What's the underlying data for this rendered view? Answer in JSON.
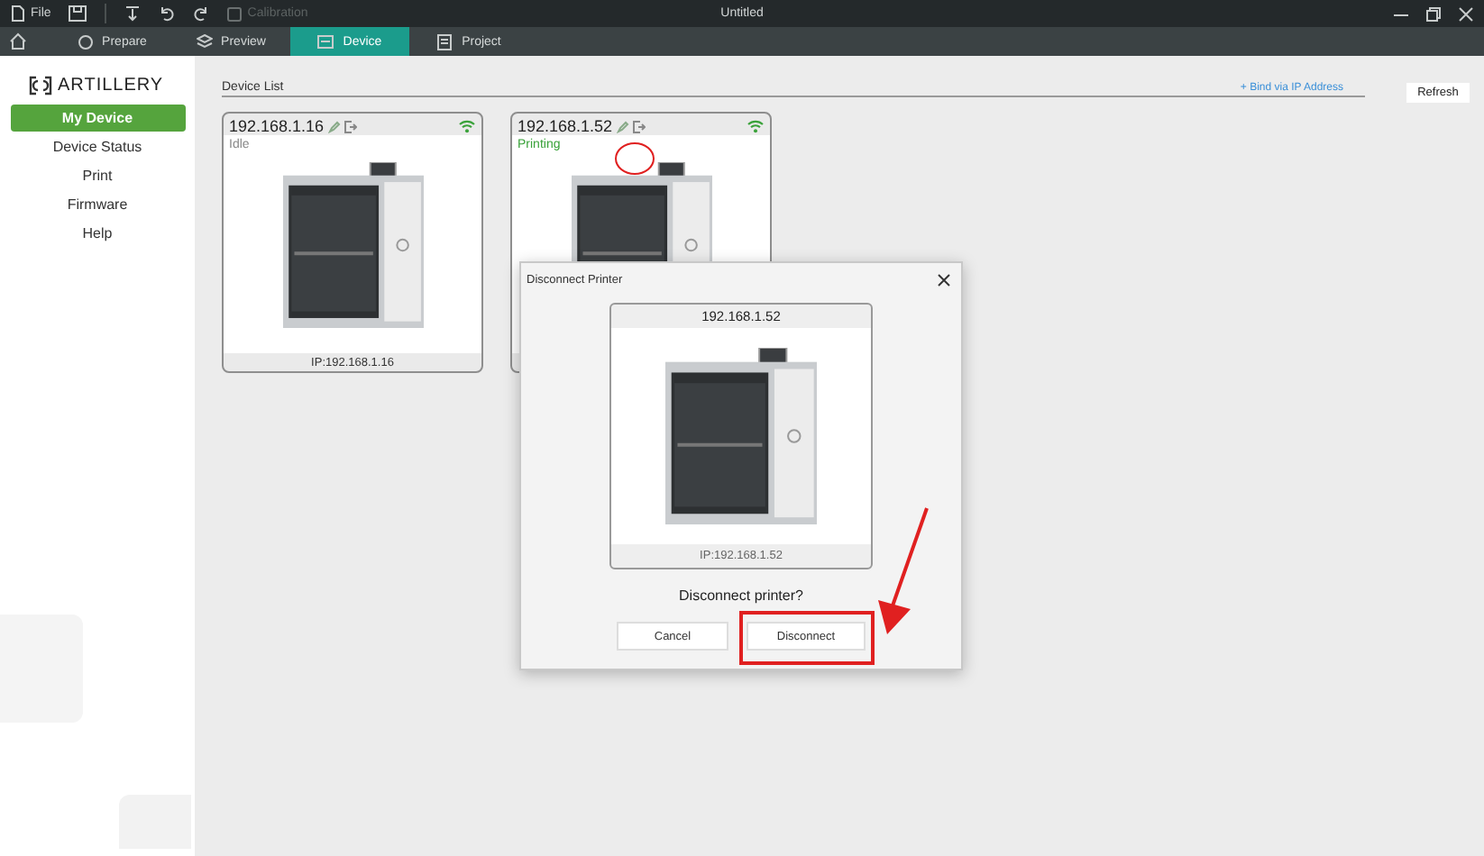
{
  "window": {
    "title": "Untitled"
  },
  "menu": {
    "file": "File",
    "items": [
      {
        "label": "Calibration",
        "disabled": true
      }
    ]
  },
  "tabs": [
    {
      "label": "Prepare",
      "selected": false
    },
    {
      "label": "Preview",
      "selected": false
    },
    {
      "label": "Device",
      "selected": true
    },
    {
      "label": "Project",
      "selected": false
    }
  ],
  "brand": "ARTILLERY",
  "sidebar": {
    "items": [
      {
        "label": "My Device",
        "selected": true
      },
      {
        "label": "Device Status",
        "selected": false
      },
      {
        "label": "Print",
        "selected": false
      },
      {
        "label": "Firmware",
        "selected": false
      },
      {
        "label": "Help",
        "selected": false
      }
    ]
  },
  "device_list": {
    "title": "Device List",
    "bind_link": "+ Bind via IP Address",
    "refresh": "Refresh",
    "devices": [
      {
        "name": "192.168.1.16",
        "status": "Idle",
        "color": "#888888",
        "online": true,
        "ip": "IP:192.168.1.16"
      },
      {
        "name": "192.168.1.52",
        "status": "Printing",
        "color": "#3aa23a",
        "online": true
      }
    ]
  },
  "dialog": {
    "title": "Disconnect Printer",
    "device_name": "192.168.1.52",
    "ip": "IP:192.168.1.52",
    "question": "Disconnect printer?",
    "buttons": [
      {
        "label": "Cancel",
        "kind": "cancel"
      },
      {
        "label": "Disconnect",
        "kind": "confirm"
      }
    ]
  }
}
